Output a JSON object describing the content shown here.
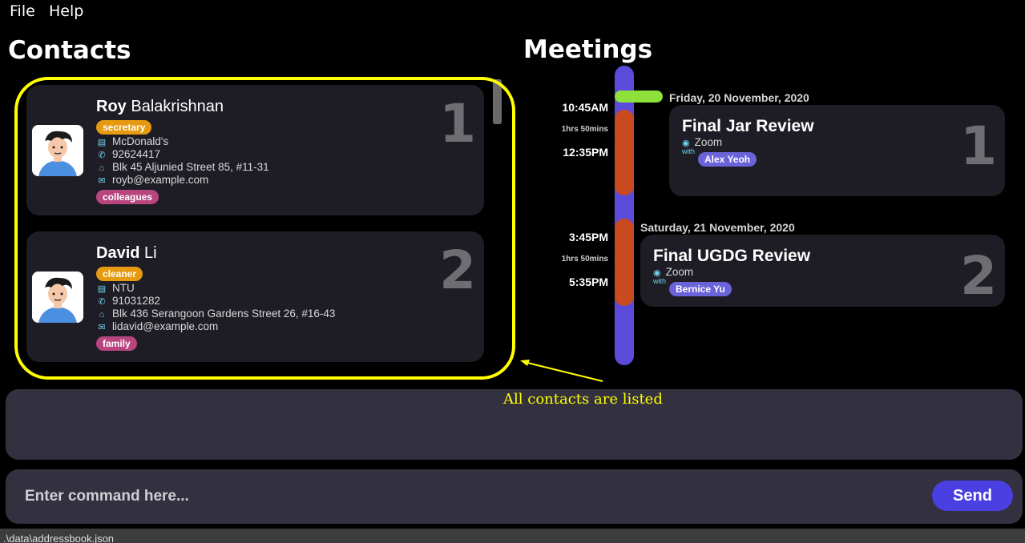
{
  "menu": {
    "items": [
      "File",
      "Help"
    ]
  },
  "contacts": {
    "title": "Contacts",
    "cards": [
      {
        "index": "1",
        "first_name": "Roy",
        "last_name": "Balakrishnan",
        "role": "secretary",
        "company": "McDonald's",
        "phone": "92624417",
        "address": "Blk 45 Aljunied Street 85, #11-31",
        "email": "royb@example.com",
        "group": "colleagues"
      },
      {
        "index": "2",
        "first_name": "David",
        "last_name": "Li",
        "role": "cleaner",
        "company": "NTU",
        "phone": "91031282",
        "address": "Blk 436 Serangoon Gardens Street 26, #16-43",
        "email": "lidavid@example.com",
        "group": "family"
      }
    ]
  },
  "meetings": {
    "title": "Meetings",
    "items": [
      {
        "index": "1",
        "date": "Friday, 20 November, 2020",
        "start": "10:45AM",
        "duration": "1hrs 50mins",
        "end": "12:35PM",
        "title": "Final Jar Review",
        "location": "Zoom",
        "with_label": "with",
        "participant": "Alex Yeoh"
      },
      {
        "index": "2",
        "date": "Saturday, 21 November, 2020",
        "start": "3:45PM",
        "duration": "1hrs 50mins",
        "end": "5:35PM",
        "title": "Final UGDG Review",
        "location": "Zoom",
        "with_label": "with",
        "participant": "Bernice Yu"
      }
    ]
  },
  "annotation": {
    "text": "All contacts are listed"
  },
  "command": {
    "placeholder": "Enter command here...",
    "send_label": "Send"
  },
  "status": {
    "path": ".\\data\\addressbook.json"
  },
  "colors": {
    "background": "#000000",
    "card": "#1e1d25",
    "panel": "#33313f",
    "accent": "#4a3fe0",
    "timeline": "#5b4bdb",
    "meeting_block": "#c94a1e",
    "now_marker": "#8ee03a",
    "highlight": "#ffff00",
    "role_tag": "#e69a0f",
    "group_tag": "#b8457e",
    "participant_tag": "#6b63d9"
  },
  "icons": [
    "building-icon",
    "phone-icon",
    "home-icon",
    "mail-icon",
    "location-pin-icon",
    "avatar"
  ]
}
